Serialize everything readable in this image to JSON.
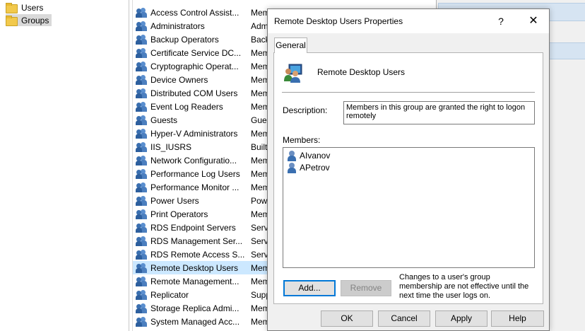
{
  "tree": {
    "items": [
      {
        "label": "Users",
        "selected": false
      },
      {
        "label": "Groups",
        "selected": true
      }
    ]
  },
  "groups": {
    "rows": [
      {
        "name": "Access Control Assist...",
        "desc": "Memb"
      },
      {
        "name": "Administrators",
        "desc": "Admin"
      },
      {
        "name": "Backup Operators",
        "desc": "Backup"
      },
      {
        "name": "Certificate Service DC...",
        "desc": "Memb"
      },
      {
        "name": "Cryptographic Operat...",
        "desc": "Memb"
      },
      {
        "name": "Device Owners",
        "desc": "Memb"
      },
      {
        "name": "Distributed COM Users",
        "desc": "Memb"
      },
      {
        "name": "Event Log Readers",
        "desc": "Memb"
      },
      {
        "name": "Guests",
        "desc": "Guests"
      },
      {
        "name": "Hyper-V Administrators",
        "desc": "Memb"
      },
      {
        "name": "IIS_IUSRS",
        "desc": "Built-in"
      },
      {
        "name": "Network Configuratio...",
        "desc": "Memb"
      },
      {
        "name": "Performance Log Users",
        "desc": "Memb"
      },
      {
        "name": "Performance Monitor ...",
        "desc": "Memb"
      },
      {
        "name": "Power Users",
        "desc": "Power"
      },
      {
        "name": "Print Operators",
        "desc": "Memb"
      },
      {
        "name": "RDS Endpoint Servers",
        "desc": "Servers"
      },
      {
        "name": "RDS Management Ser...",
        "desc": "Servers"
      },
      {
        "name": "RDS Remote Access S...",
        "desc": "Servers"
      },
      {
        "name": "Remote Desktop Users",
        "desc": "Memb"
      },
      {
        "name": "Remote Management...",
        "desc": "Memb"
      },
      {
        "name": "Replicator",
        "desc": "Suppo"
      },
      {
        "name": "Storage Replica Admi...",
        "desc": "Memb"
      },
      {
        "name": "System Managed Acc...",
        "desc": "Memb"
      }
    ]
  },
  "dialog": {
    "title": "Remote Desktop Users Properties",
    "help_glyph": "?",
    "close_glyph": "✕",
    "tab_label": "General",
    "group_name": "Remote Desktop Users",
    "description_label": "Description:",
    "description_value": "Members in this group are granted the right to logon remotely",
    "members_label": "Members:",
    "members": [
      "AIvanov",
      "APetrov"
    ],
    "add_label": "Add...",
    "remove_label": "Remove",
    "note": "Changes to a user's group membership are not effective until the next time the user logs on.",
    "ok_label": "OK",
    "cancel_label": "Cancel",
    "apply_label": "Apply",
    "help_label": "Help"
  },
  "icons": {
    "tree_folder": "folder-icon",
    "group": "group-icon",
    "user": "user-icon"
  },
  "colors": {
    "selection": "#cce8ff",
    "accent": "#0078d7"
  }
}
